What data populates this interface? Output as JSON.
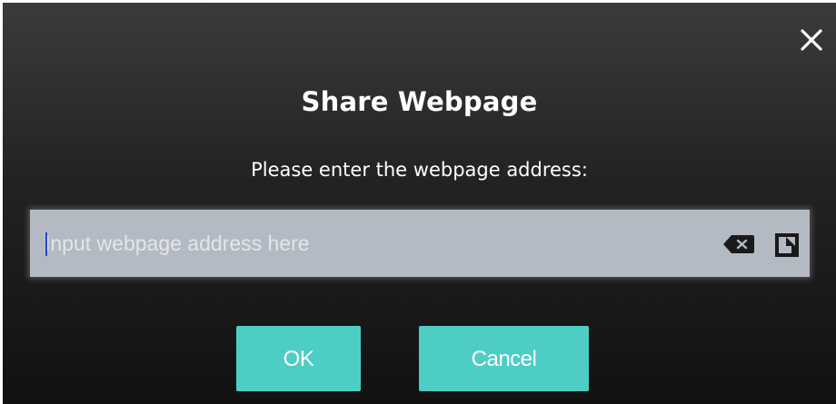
{
  "dialog": {
    "title": "Share Webpage",
    "prompt": "Please enter the webpage address:",
    "input": {
      "value": "",
      "placeholder": "Input webpage address here"
    },
    "buttons": {
      "ok_label": "OK",
      "cancel_label": "Cancel"
    },
    "icons": {
      "close": "close-icon",
      "clear": "backspace-clear-icon",
      "paste": "paste-icon"
    }
  },
  "colors": {
    "accent": "#4ecdc4",
    "input_bg": "#b4bac3",
    "dialog_bg_top": "#3b3b3b",
    "dialog_bg_bottom": "#111111",
    "caret": "#2a46c8"
  }
}
